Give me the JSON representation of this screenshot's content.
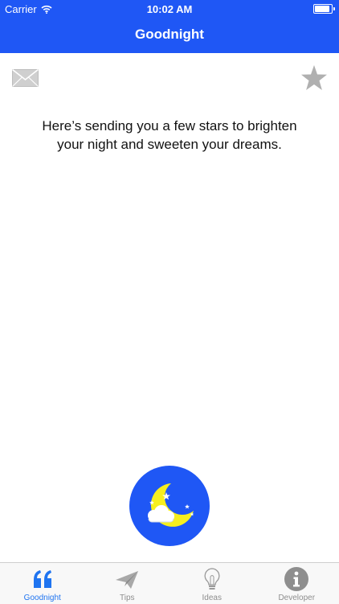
{
  "status_bar": {
    "carrier": "Carrier",
    "time": "10:02 AM",
    "battery_level": 1.0
  },
  "nav": {
    "title": "Goodnight"
  },
  "message": {
    "text": "Here’s sending you a few stars to brighten your night and sweeten your dreams."
  },
  "colors": {
    "accent": "#1f57f5",
    "tab_active": "#1f74f0",
    "tab_inactive": "#8e8e8e",
    "moon": "#f6ef1e"
  },
  "icons": {
    "mail": "envelope-icon",
    "favorite": "star-icon",
    "moon_button": "moon-cloud-icon"
  },
  "tabs": [
    {
      "label": "Goodnight",
      "icon": "quote-icon",
      "active": true
    },
    {
      "label": "Tips",
      "icon": "paper-plane-icon",
      "active": false
    },
    {
      "label": "Ideas",
      "icon": "lightbulb-icon",
      "active": false
    },
    {
      "label": "Developer",
      "icon": "info-icon",
      "active": false
    }
  ]
}
